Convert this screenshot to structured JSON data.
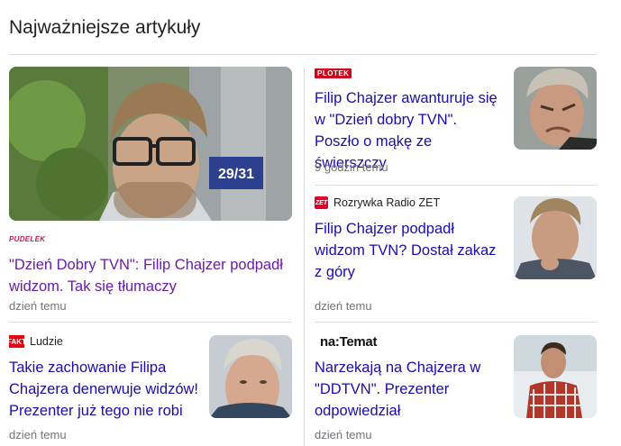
{
  "section": {
    "title": "Najważniejsze artykuły"
  },
  "colors": {
    "link": "#1a0dab",
    "visited": "#681da8",
    "meta": "#70757a",
    "divider": "#dadce0"
  },
  "articles": [
    {
      "source_logo_text": "PUDELEK",
      "source_name": "",
      "headline": "\"Dzień Dobry TVN\": Filip Chajzer podpadł widzom. Tak się tłumaczy",
      "time": "dzień temu",
      "thumbnail": "photo-man-glasses-city"
    },
    {
      "source_logo_text": "PLOTEK",
      "source_name": "",
      "headline": "Filip Chajzer awanturuje się w \"Dzień dobry TVN\". Poszło o mąkę ze świerszczy",
      "time": "9 godzin temu",
      "thumbnail": "photo-man-grimace"
    },
    {
      "source_logo_text": "ZET",
      "source_name": "Rozrywka Radio ZET",
      "headline": "Filip Chajzer podpadł widzom TVN? Dostał zakaz z góry",
      "time": "dzień temu",
      "thumbnail": "photo-man-thinking"
    },
    {
      "source_logo_text": "FAKT",
      "source_name": "Ludzie",
      "headline": "Takie zachowanie Filipa Chajzera denerwuje widzów! Prezenter już tego nie robi",
      "time": "dzień temu",
      "thumbnail": "photo-man-closeup"
    },
    {
      "source_logo_text": "na:Temat",
      "source_name": "",
      "headline": "Narzekają na Chajzera w \"DDTVN\". Prezenter odpowiedział",
      "time": "dzień temu",
      "thumbnail": "photo-man-plaid-shirt"
    }
  ],
  "sign_text": "29/31"
}
